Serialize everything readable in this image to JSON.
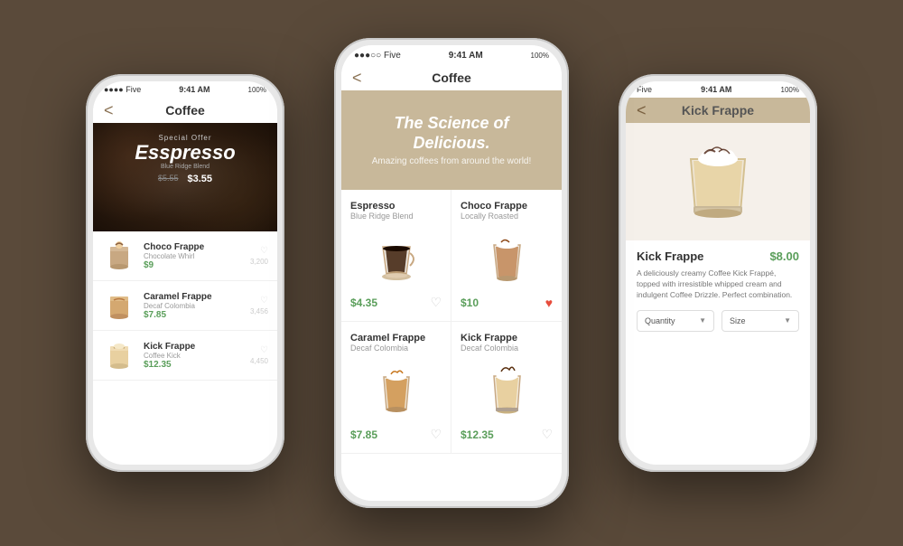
{
  "background_color": "#5a4a3a",
  "phones": {
    "left": {
      "status": {
        "signal": "●●●● Five",
        "wifi": "▲",
        "time": "9:41 AM",
        "battery": "100%"
      },
      "nav": {
        "back": "<",
        "title": "Coffee"
      },
      "hero": {
        "special_label": "Special Offer",
        "product_name": "Esspresso",
        "product_sub": "Blue Ridge Blend",
        "old_price": "$5.55",
        "new_price": "$3.55"
      },
      "items": [
        {
          "name": "Choco Frappe",
          "desc": "Chocolate Whirl",
          "price": "$9",
          "likes": "3,200",
          "cup_type": "choco"
        },
        {
          "name": "Caramel Frappe",
          "desc": "Decaf Colombia",
          "price": "$7.85",
          "likes": "3,456",
          "cup_type": "caramel"
        },
        {
          "name": "Kick Frappe",
          "desc": "Coffee Kick",
          "price": "$12.35",
          "likes": "4,450",
          "cup_type": "kick"
        }
      ]
    },
    "center": {
      "status": {
        "signal": "●●●○○ Five",
        "wifi": "▲",
        "time": "9:41 AM",
        "battery": "100%"
      },
      "nav": {
        "back": "<",
        "title": "Coffee"
      },
      "hero": {
        "title": "The Science of Delicious.",
        "subtitle": "Amazing coffees from around the world!"
      },
      "grid": [
        {
          "name": "Espresso",
          "desc": "Blue Ridge Blend",
          "price": "$4.35",
          "heart": "♡",
          "heart_color": "#ccc",
          "cup_type": "espresso"
        },
        {
          "name": "Choco Frappe",
          "desc": "Locally Roasted",
          "price": "$10",
          "heart": "♥",
          "heart_color": "#e74c3c",
          "cup_type": "choco"
        },
        {
          "name": "Caramel Frappe",
          "desc": "Decaf Colombia",
          "price": "$7.85",
          "heart": "♡",
          "heart_color": "#ccc",
          "cup_type": "caramel"
        },
        {
          "name": "Kick Frappe",
          "desc": "Decaf Colombia",
          "price": "$12.35",
          "heart": "♡",
          "heart_color": "#ccc",
          "cup_type": "kick"
        }
      ]
    },
    "right": {
      "status": {
        "signal": "Five",
        "wifi": "▲",
        "time": "9:41 AM",
        "battery": "100%"
      },
      "nav": {
        "back": "<",
        "title": "Kick Frappe"
      },
      "product": {
        "name": "Kick Frappe",
        "price": "$8.00",
        "description": "A deliciously creamy Coffee Kick Frappé, topped with irresistible whipped cream and indulgent Coffee Drizzle. Perfect combination.",
        "quantity_label": "Quantity",
        "size_label": "Size",
        "cup_type": "kick_large"
      }
    }
  }
}
